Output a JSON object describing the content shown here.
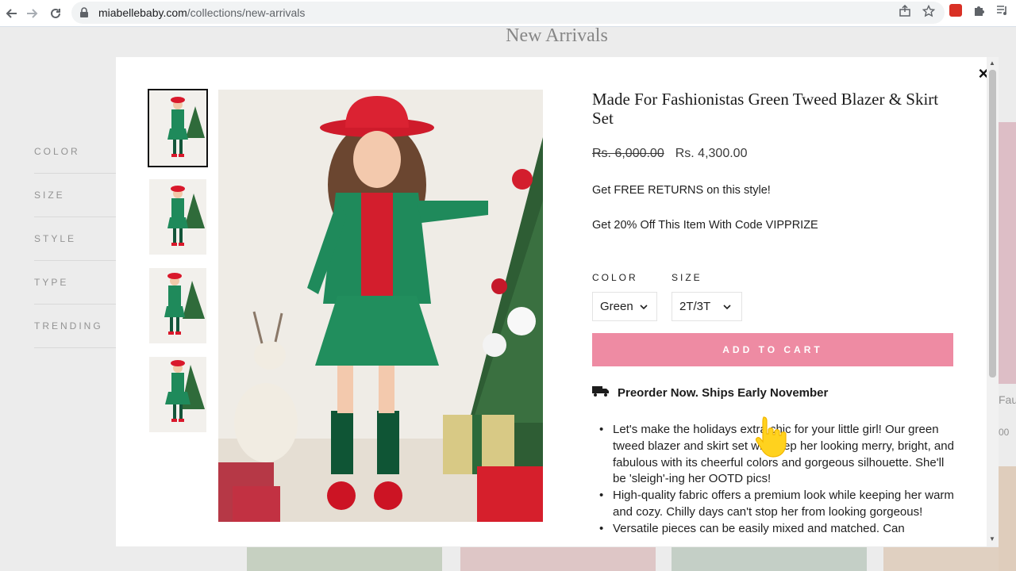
{
  "browser": {
    "url_host": "miabellebaby.com",
    "url_path": "/collections/new-arrivals",
    "icons": [
      "back-icon",
      "forward-icon",
      "reload-icon",
      "lock-icon",
      "share-icon",
      "star-icon",
      "extension-icon",
      "puzzle-icon",
      "playlist-icon"
    ]
  },
  "page": {
    "title": "New Arrivals",
    "filters": [
      "COLOR",
      "SIZE",
      "STYLE",
      "TYPE",
      "TRENDING"
    ],
    "right_peek_text": [
      "Fau",
      "00"
    ]
  },
  "modal": {
    "close_label": "×",
    "product_title": "Made For Fashionistas Green Tweed Blazer & Skirt Set",
    "price_original": "Rs. 6,000.00",
    "price_sale": "Rs. 4,300.00",
    "promo_returns": "Get FREE RETURNS on this style!",
    "promo_code": "Get 20% Off This Item With Code VIPPRIZE",
    "color_label": "COLOR",
    "color_value": "Green",
    "size_label": "SIZE",
    "size_value": "2T/3T",
    "add_to_cart": "ADD TO CART",
    "shipping_note": "Preorder Now. Ships Early November",
    "bullets": [
      "Let's make the holidays extra chic for your little girl! Our green tweed blazer and skirt set will keep her looking merry, bright, and fabulous with its cheerful colors and gorgeous silhouette. She'll be 'sleigh'-ing her OOTD pics!",
      "High-quality fabric offers a premium look while keeping her warm and cozy. Chilly days can't stop her from looking gorgeous!",
      "Versatile pieces can be easily mixed and matched. Can"
    ],
    "thumbnail_count": 4,
    "colors": {
      "accent_pink": "#ee8ba3",
      "outfit_green": "#1f8a5b",
      "hat_red": "#d9182b"
    }
  }
}
